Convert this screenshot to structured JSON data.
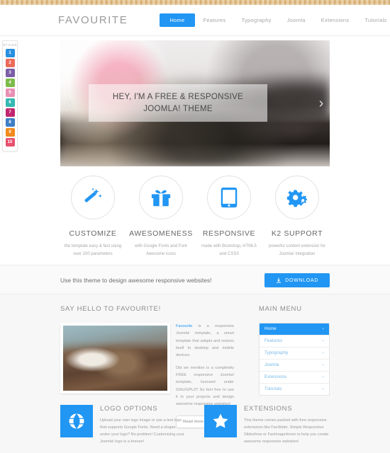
{
  "header": {
    "brand": "FAVOURITE",
    "nav": [
      {
        "label": "Home",
        "active": true
      },
      {
        "label": "Features",
        "active": false
      },
      {
        "label": "Typography",
        "active": false
      },
      {
        "label": "Joomla",
        "active": false
      },
      {
        "label": "Extensions",
        "active": false
      },
      {
        "label": "Tutorials",
        "active": false
      }
    ]
  },
  "styles_panel": {
    "title": "STYLES",
    "swatches": [
      {
        "number": "1",
        "color": "#2b8fe0"
      },
      {
        "number": "2",
        "color": "#ec6b5a"
      },
      {
        "number": "3",
        "color": "#7b5ea7"
      },
      {
        "number": "4",
        "color": "#7cbb4a"
      },
      {
        "number": "5",
        "color": "#e88fb4"
      },
      {
        "number": "6",
        "color": "#35b8b3"
      },
      {
        "number": "7",
        "color": "#c2256e"
      },
      {
        "number": "8",
        "color": "#3d7ec4"
      },
      {
        "number": "9",
        "color": "#f28a1c"
      },
      {
        "number": "10",
        "color": "#e8506f"
      }
    ]
  },
  "hero": {
    "line1": "HEY, I'M A FREE & RESPONSIVE",
    "line2": "JOOMLA! THEME",
    "prev_arrow": "‹",
    "next_arrow": "›"
  },
  "features": [
    {
      "icon": "magic-wand-icon",
      "title": "CUSTOMIZE",
      "desc": "the template easy & fast using over 200 parameters"
    },
    {
      "icon": "gift-icon",
      "title": "AWESOMENESS",
      "desc": "with Google Fonts and Font Awesome icons"
    },
    {
      "icon": "tablet-icon",
      "title": "RESPONSIVE",
      "desc": "made with Bootstrap, HTML5 and CSS3"
    },
    {
      "icon": "gears-icon",
      "title": "K2 SUPPORT",
      "desc": "powerful content extension for Joomla! integration"
    }
  ],
  "cta": {
    "text": "Use this theme to design awesome responsive websites!",
    "button_label": "DOWNLOAD",
    "button_color": "#2196f3"
  },
  "about": {
    "heading": "SAY HELLO TO FAVOURITE!",
    "link_text": "Favourite",
    "paragraph1_rest": " is a responsive Joomla! template, a smart template that adapts and resizes itself to desktop and mobile devices.",
    "paragraph2": "Did we mention is a completely FREE responsive Joomla! template, licensed under GNU/GPL3? So feel free to use it in your projects and design awesome responsive websites!",
    "readmore_label": "Read more...",
    "readmore_chevron": "›"
  },
  "main_menu": {
    "heading": "MAIN MENU",
    "items": [
      {
        "label": "Home",
        "active": true,
        "chevron": "›"
      },
      {
        "label": "Features",
        "active": false,
        "chevron": "›"
      },
      {
        "label": "Typography",
        "active": false,
        "chevron": "›"
      },
      {
        "label": "Joomla",
        "active": false,
        "chevron": "›"
      },
      {
        "label": "Extensions",
        "active": false,
        "chevron": "›"
      },
      {
        "label": "Tutorials",
        "active": false,
        "chevron": "›"
      }
    ]
  },
  "boxes": [
    {
      "icon": "globe-icon",
      "title": "LOGO OPTIONS",
      "desc": "Upload your own logo image or use a text logo that supports Google Fonts. Need a slogan under your logo? No problem! Customizing your Joomla! logo is a breeze!"
    },
    {
      "icon": "star-icon",
      "title": "EXTENSIONS",
      "desc": "This theme comes packed with free responsive extensions like FavSlider, Simple Responsive Slideshow or FavImageHover to help you create awesome responsive websites!"
    }
  ]
}
